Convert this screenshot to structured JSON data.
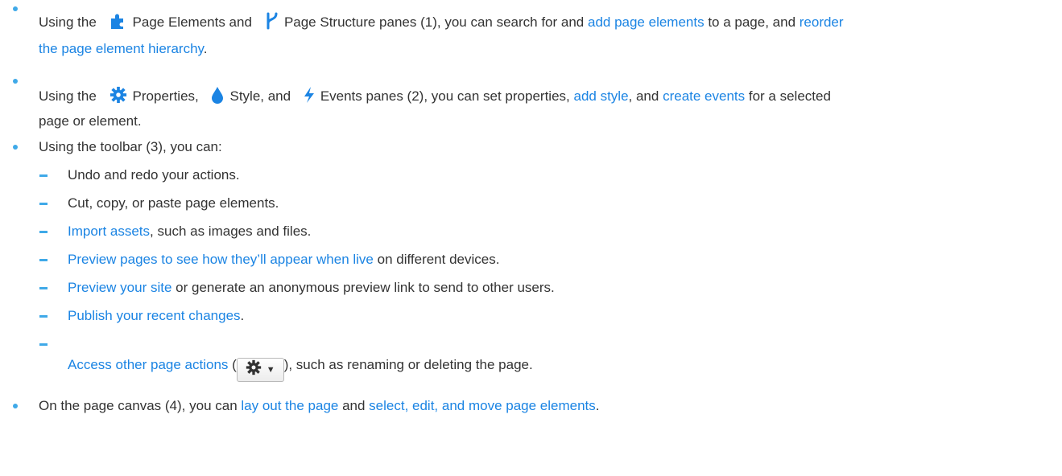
{
  "bullets": [
    {
      "line1": {
        "t1": "Using the ",
        "icon1_name": "puzzle-icon",
        "t2": "Page Elements and",
        "icon2_name": "hierarchy-icon",
        "t3": "Page Structure panes (1), you can search for and ",
        "link1": "add page elements",
        "t4": " to a page, and ",
        "link2a": "reorder"
      },
      "line2": {
        "link2b": "the page element hierarchy",
        "t5": "."
      }
    },
    {
      "line1": {
        "t1": "Using the ",
        "icon1_name": "gear-icon",
        "t2": "Properties, ",
        "icon2_name": "drop-icon",
        "t3": "Style, and ",
        "icon3_name": "bolt-icon",
        "t4": "Events panes (2), you can set properties, ",
        "link1": "add style",
        "t5": ", and ",
        "link2": "create events",
        "t6": " for a selected"
      },
      "line2": {
        "t7": "page or element."
      }
    },
    {
      "text": "Using the toolbar (3), you can:"
    }
  ],
  "sub_items": [
    {
      "text": "Undo and redo your actions."
    },
    {
      "text": "Cut, copy, or paste page elements."
    },
    {
      "link": "Import assets",
      "text": ", such as images and files."
    },
    {
      "link": "Preview pages to see how they’ll appear when live",
      "text": " on different devices."
    },
    {
      "link": "Preview your site",
      "text": " or generate an anonymous preview link to send to other users."
    },
    {
      "link": "Publish your recent changes",
      "text": "."
    },
    {
      "link": "Access other page actions",
      "pre_btn": " (",
      "post_btn": "), such as renaming or deleting the page.",
      "button_icon": "gear-icon",
      "button_caret": "▼"
    }
  ],
  "last_bullet": {
    "t1": "On the page canvas (4), you can ",
    "link1": "lay out the page",
    "t2": " and ",
    "link2": "select, edit, and move page elements",
    "t3": "."
  },
  "colors": {
    "accent": "#3fa9e8",
    "link": "#1b84e3",
    "text": "#333333"
  }
}
